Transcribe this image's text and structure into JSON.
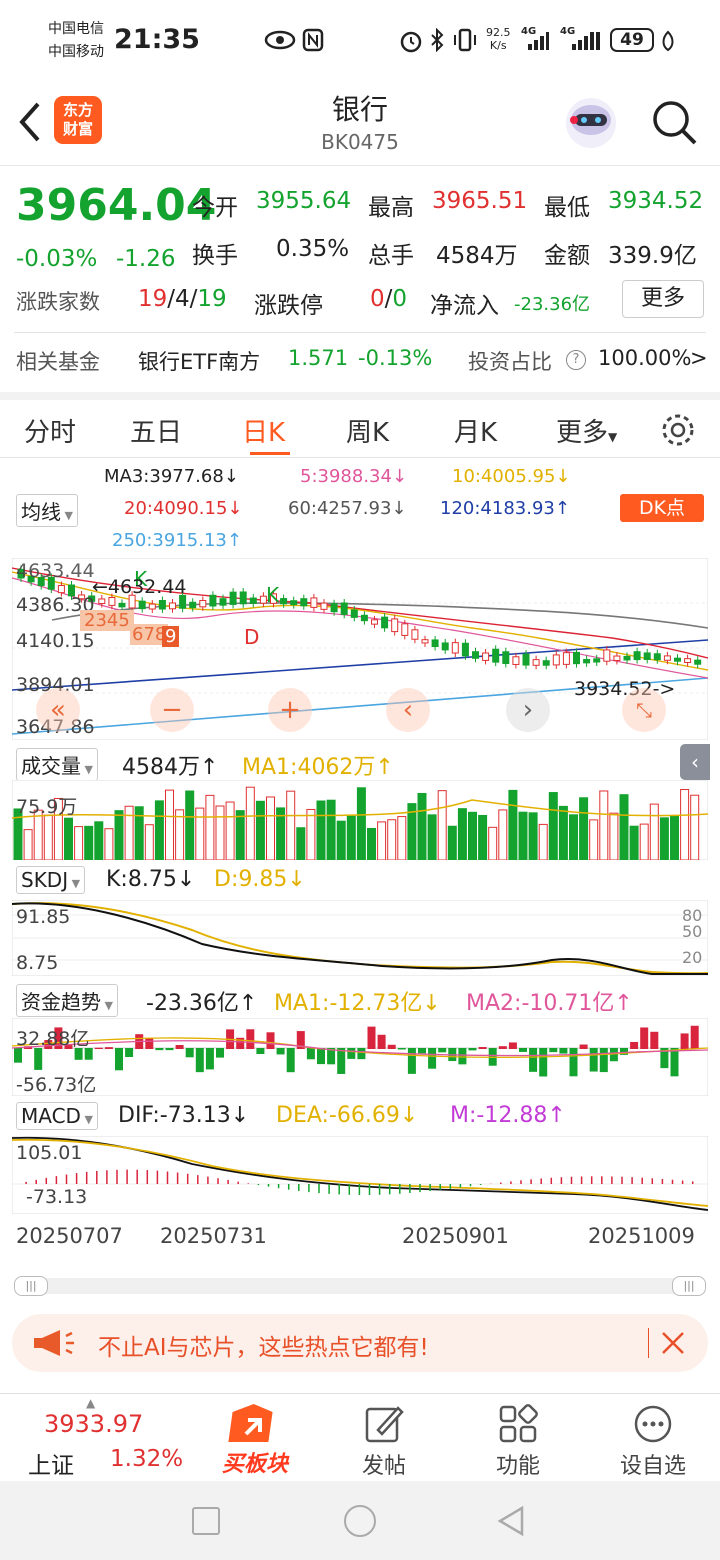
{
  "status_bar": {
    "carrier1": "中国电信",
    "carrier2": "中国移动",
    "time": "21:35",
    "net_speed_top": "92.5",
    "net_speed_bottom": "K/s",
    "sig1": "4G",
    "sig2": "4G",
    "battery": "49"
  },
  "header": {
    "logo_line1": "东方",
    "logo_line2": "财富",
    "title": "银行",
    "code": "BK0475"
  },
  "quote": {
    "price": "3964.04",
    "change_pct": "-0.03%",
    "change": "-1.26",
    "open_label": "今开",
    "open": "3955.64",
    "high_label": "最高",
    "high": "3965.51",
    "low_label": "最低",
    "low": "3934.52",
    "turnover_label": "换手",
    "turnover": "0.35%",
    "volume_label": "总手",
    "volume": "4584万",
    "amount_label": "金额",
    "amount": "339.9亿",
    "advdec_label": "涨跌家数",
    "adv": "19",
    "sep1": "/",
    "flat": "4",
    "sep2": "/",
    "dec": "19",
    "limit_label": "涨跌停",
    "limit_up": "0",
    "sep3": "/",
    "limit_down": "0",
    "netflow_label": "净流入",
    "netflow": "-23.36亿",
    "more_button": "更多"
  },
  "fund": {
    "label": "相关基金",
    "name": "银行ETF南方",
    "price": "1.571",
    "pct": "-0.13%",
    "ratio_label": "投资占比",
    "ratio": "100.00%",
    "arrow": ">",
    "help": "?"
  },
  "tabs": [
    {
      "label": "分时"
    },
    {
      "label": "五日"
    },
    {
      "label": "日K",
      "active": true
    },
    {
      "label": "周K"
    },
    {
      "label": "月K"
    },
    {
      "label": "更多"
    }
  ],
  "ma": {
    "selector": "均线",
    "ma3": "MA3:3977.68↓",
    "ma5": "5:3988.34↓",
    "ma10": "10:4005.95↓",
    "ma20": "20:4090.15↓",
    "ma60": "60:4257.93↓",
    "ma120": "120:4183.93↑",
    "ma250": "250:3915.13↑",
    "dk": "DK点"
  },
  "kline": {
    "y_labels": [
      "4633.44",
      "4386.30",
      "4140.15",
      "3894.01",
      "3647.86"
    ],
    "high_mark": "4632.44",
    "low_mark": "3934.52->",
    "seq": "2345",
    "seq2": "678",
    "seq3": "9",
    "k1": "K",
    "k2": "K",
    "d": "D"
  },
  "vol": {
    "selector": "成交量",
    "value": "4584万↑",
    "ma1": "MA1:4062万↑",
    "axis": "75.9万"
  },
  "skdj": {
    "selector": "SKDJ",
    "k": "K:8.75↓",
    "d": "D:9.85↓",
    "y1": "91.85",
    "y2": "8.75",
    "lvl80": "80",
    "lvl50": "50",
    "lvl20": "20"
  },
  "fund_trend": {
    "selector": "资金趋势",
    "value": "-23.36亿↑",
    "ma1": "MA1:-12.73亿↓",
    "ma2": "MA2:-10.71亿↑",
    "y1": "32.88亿",
    "y2": "-56.73亿"
  },
  "macd": {
    "selector": "MACD",
    "dif": "DIF:-73.13↓",
    "dea": "DEA:-66.69↓",
    "m": "M:-12.88↑",
    "y1": "105.01",
    "y2": "-73.13"
  },
  "dates": [
    "20250707",
    "20250731",
    "20250901",
    "20251009"
  ],
  "banner": {
    "text": "不止AI与芯片，这些热点它都有!"
  },
  "bottom": {
    "index_value": "3933.97",
    "index_name": "上证",
    "index_pct": "1.32%",
    "buy": "买板块",
    "post": "发帖",
    "func": "功能",
    "watch": "设自选"
  },
  "colors": {
    "up": "#e03030",
    "down": "#13a32e",
    "accent": "#ff5a1f"
  }
}
